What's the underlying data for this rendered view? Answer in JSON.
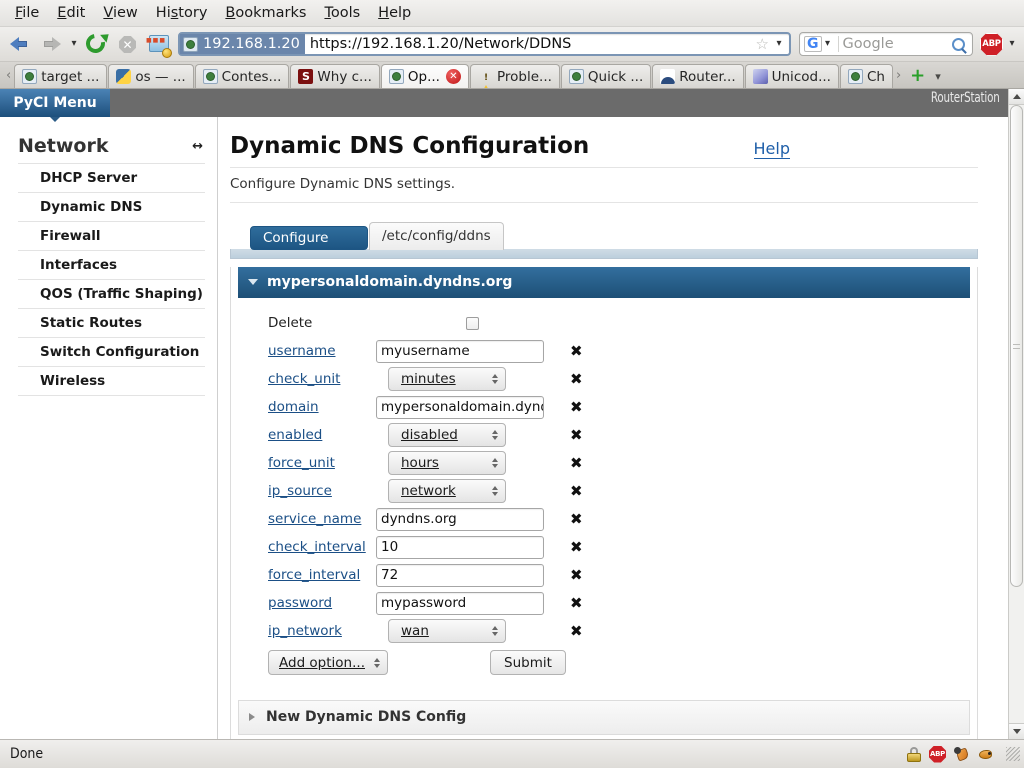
{
  "browser": {
    "menu_items": [
      {
        "pre": "",
        "hot": "F",
        "post": "ile"
      },
      {
        "pre": "",
        "hot": "E",
        "post": "dit"
      },
      {
        "pre": "",
        "hot": "V",
        "post": "iew"
      },
      {
        "pre": "Hi",
        "hot": "s",
        "post": "tory"
      },
      {
        "pre": "",
        "hot": "B",
        "post": "ookmarks"
      },
      {
        "pre": "",
        "hot": "T",
        "post": "ools"
      },
      {
        "pre": "",
        "hot": "H",
        "post": "elp"
      }
    ],
    "nav": {
      "back_icon": "back-arrow-icon",
      "forward_icon": "forward-arrow-icon",
      "history_dropdown_icon": "chevron-down-icon",
      "reload_icon": "reload-icon",
      "stop_icon": "stop-icon",
      "home_icon": "home-icon"
    },
    "address": {
      "identity_label": "192.168.1.20",
      "url": "https://192.168.1.20/Network/DDNS",
      "bookmark_star_icon": "star-icon",
      "go_dropdown_icon": "chevron-down-icon"
    },
    "search": {
      "engine": "G",
      "placeholder": "Google",
      "search_icon": "magnifier-icon",
      "engine_dropdown_icon": "chevron-down-icon"
    },
    "adblock": {
      "label": "ABP",
      "dropdown_icon": "chevron-down-icon"
    },
    "tabs": {
      "scroll_left_icon": "chevron-left-icon",
      "scroll_right_icon": "chevron-right-icon",
      "new_tab_label": "+",
      "list_all_icon": "chevron-down-icon",
      "close_label": "✕",
      "items": [
        {
          "title": "target ...",
          "favicon": "generic-page-icon",
          "active": false
        },
        {
          "title": "os — ...",
          "favicon": "python-icon",
          "active": false
        },
        {
          "title": "Contes...",
          "favicon": "generic-page-icon",
          "active": false
        },
        {
          "title": "Why c...",
          "favicon": "stackoverflow-icon",
          "active": false
        },
        {
          "title": "Op...",
          "favicon": "generic-page-icon",
          "active": true
        },
        {
          "title": "Proble...",
          "favicon": "warning-icon",
          "active": false
        },
        {
          "title": "Quick ...",
          "favicon": "generic-page-icon",
          "active": false
        },
        {
          "title": "Router...",
          "favicon": "router-icon",
          "active": false
        },
        {
          "title": "Unicod...",
          "favicon": "unicode-icon",
          "active": false
        },
        {
          "title": "Ch",
          "favicon": "generic-page-icon",
          "active": false
        }
      ]
    },
    "status": {
      "text": "Done",
      "icons": [
        "lock-icon",
        "adblock-icon",
        "bug-icon",
        "bird-icon"
      ]
    }
  },
  "app": {
    "menu_button": "PyCI Menu",
    "brand": "RouterStation",
    "sidebar": {
      "heading": "Network",
      "collapse_icon": "resize-horizontal-icon",
      "items": [
        {
          "label": "DHCP Server"
        },
        {
          "label": "Dynamic DNS"
        },
        {
          "label": "Firewall"
        },
        {
          "label": "Interfaces"
        },
        {
          "label": "QOS (Traffic Shaping)"
        },
        {
          "label": "Static Routes"
        },
        {
          "label": "Switch Configuration"
        },
        {
          "label": "Wireless"
        }
      ]
    },
    "page": {
      "title": "Dynamic DNS Configuration",
      "help_label": "Help",
      "subtitle": "Configure Dynamic DNS settings.",
      "tabs": [
        {
          "label": "Configure",
          "selected": true
        },
        {
          "label": "/etc/config/ddns",
          "selected": false
        }
      ],
      "section": {
        "title": "mypersonaldomain.dyndns.org",
        "expanded": true,
        "toggle_icon": "triangle-down-icon",
        "delete_row": {
          "label": "Delete",
          "checked": false
        },
        "fields": [
          {
            "name": "username",
            "type": "text",
            "value": "myusername",
            "remove_icon": "remove-x-icon"
          },
          {
            "name": "check_unit",
            "type": "select",
            "value": "minutes",
            "remove_icon": "remove-x-icon"
          },
          {
            "name": "domain",
            "type": "text",
            "value": "mypersonaldomain.dyndn",
            "remove_icon": "remove-x-icon"
          },
          {
            "name": "enabled",
            "type": "select",
            "value": "disabled",
            "remove_icon": "remove-x-icon"
          },
          {
            "name": "force_unit",
            "type": "select",
            "value": "hours",
            "remove_icon": "remove-x-icon"
          },
          {
            "name": "ip_source",
            "type": "select",
            "value": "network",
            "remove_icon": "remove-x-icon"
          },
          {
            "name": "service_name",
            "type": "text",
            "value": "dyndns.org",
            "remove_icon": "remove-x-icon"
          },
          {
            "name": "check_interval",
            "type": "text",
            "value": "10",
            "remove_icon": "remove-x-icon"
          },
          {
            "name": "force_interval",
            "type": "text",
            "value": "72",
            "remove_icon": "remove-x-icon"
          },
          {
            "name": "password",
            "type": "text",
            "value": "mypassword",
            "remove_icon": "remove-x-icon"
          },
          {
            "name": "ip_network",
            "type": "select",
            "value": "wan",
            "remove_icon": "remove-x-icon"
          }
        ],
        "add_option_label": "Add option...",
        "submit_label": "Submit"
      },
      "new_section": {
        "title": "New Dynamic DNS Config",
        "expanded": false,
        "toggle_icon": "triangle-right-icon"
      }
    }
  }
}
